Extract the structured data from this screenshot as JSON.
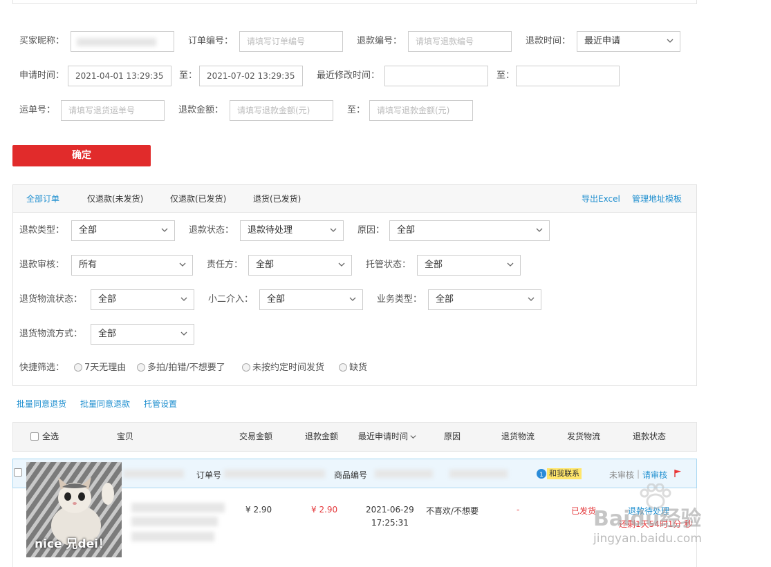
{
  "filters": {
    "buyer_label": "买家昵称：",
    "order_no_label": "订单编号：",
    "order_no_placeholder": "请填写订单编号",
    "refund_no_label": "退款编号：",
    "refund_no_placeholder": "请填写退款编号",
    "refund_time_label": "退款时间：",
    "refund_time_value": "最近申请",
    "apply_time_label": "申请时间：",
    "apply_time_start": "2021-04-01 13:29:35",
    "to_label": "至：",
    "apply_time_end": "2021-07-02 13:29:35",
    "modified_time_label": "最近修改时间：",
    "waybill_label": "运单号：",
    "waybill_placeholder": "请填写退货运单号",
    "amount_label": "退款金额：",
    "amount_placeholder": "请填写退款金额(元)",
    "confirm_button": "确定"
  },
  "tabs": [
    {
      "label": "全部订单"
    },
    {
      "label": "仅退款(未发货)"
    },
    {
      "label": "仅退款(已发货)"
    },
    {
      "label": "退货(已发货)"
    }
  ],
  "tab_links": {
    "export": "导出Excel",
    "address": "管理地址模板"
  },
  "panel": {
    "refund_type_label": "退款类型：",
    "refund_type_value": "全部",
    "refund_status_label": "退款状态：",
    "refund_status_value": "退款待处理",
    "reason_label": "原因：",
    "reason_value": "全部",
    "audit_label": "退款审核：",
    "audit_value": "所有",
    "responsible_label": "责任方：",
    "responsible_value": "全部",
    "custody_label": "托管状态：",
    "custody_value": "全部",
    "logistics_status_label": "退货物流状态：",
    "logistics_status_value": "全部",
    "xiaoer_label": "小二介入：",
    "xiaoer_value": "全部",
    "business_label": "业务类型：",
    "business_value": "全部",
    "logistics_method_label": "退货物流方式：",
    "logistics_method_value": "全部",
    "quick_label": "快捷筛选：",
    "quick_options": [
      "7天无理由",
      "多拍/拍错/不想要了",
      "未按约定时间发货",
      "缺货"
    ]
  },
  "batch_actions": [
    "批量同意退货",
    "批量同意退款",
    "托管设置"
  ],
  "table_header": {
    "select_all": "全选",
    "item": "宝贝",
    "trade_amount": "交易金额",
    "refund_amount": "退款金额",
    "latest_apply": "最近申请时间",
    "reason": "原因",
    "return_logistics": "退货物流",
    "ship_logistics": "发货物流",
    "refund_status": "退款状态"
  },
  "order": {
    "order_no_label": "订单号",
    "goods_no_label": "商品编号",
    "contact_badge": "和我联系",
    "unaudited": "未审核",
    "separator": "|",
    "request_audit": "请审核",
    "trade_amount": "¥ 2.90",
    "refund_amount": "¥ 2.90",
    "apply_date": "2021-06-29",
    "apply_time": "17:25:31",
    "reason": "不喜欢/不想要",
    "return_logistics": "-",
    "ship_status": "已发货",
    "refund_status_line1": "退款待处理",
    "refund_status_line2": "还剩1天54时1分 秒"
  },
  "sticker": {
    "caption": "nice 兄dei！"
  },
  "watermark": {
    "brand": "Baidu经验",
    "url": "jingyan.baidu.com"
  },
  "colors": {
    "accent": "#1d8ecf",
    "confirm": "#e12b2b",
    "price": "#e4393c"
  }
}
